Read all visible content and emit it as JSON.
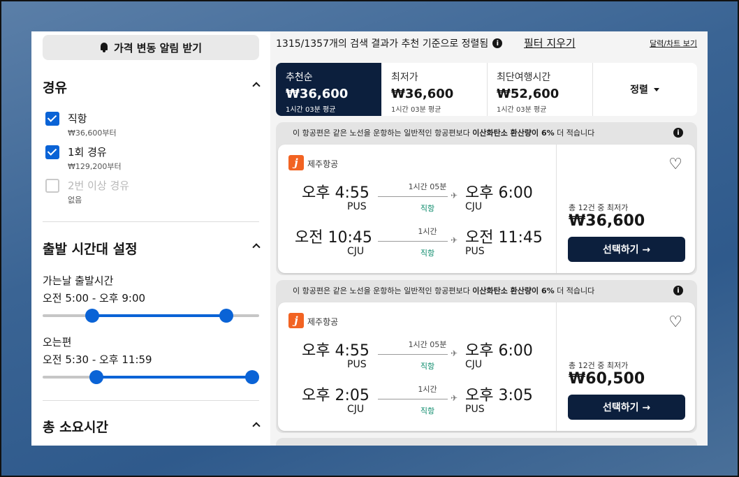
{
  "sidebar": {
    "alert_button": "가격 변동 알림 받기",
    "stops": {
      "title": "경유",
      "options": [
        {
          "label": "직항",
          "sub": "₩36,600부터",
          "checked": true
        },
        {
          "label": "1회 경유",
          "sub": "₩129,200부터",
          "checked": true
        },
        {
          "label": "2번 이상 경유",
          "sub": "없음",
          "checked": false
        }
      ]
    },
    "departure_time": {
      "title": "출발 시간대 설정",
      "outbound_label": "가는날 출발시간",
      "outbound_range": "오전 5:00 - 오후 9:00",
      "return_label": "오는편",
      "return_range": "오전 5:30 - 오후 11:59"
    },
    "duration": {
      "title": "총 소요시간"
    }
  },
  "main": {
    "results_text": "1315/1357개의 검색 결과가 추천 기준으로 정렬됨",
    "info_glyph": "i",
    "clear_filters": "필터 지우기",
    "dollar_chart": "달력/차트 보기",
    "sort_tabs": [
      {
        "label": "추천순",
        "price": "₩36,600",
        "sub": "1시간 03분 평균",
        "active": true
      },
      {
        "label": "최저가",
        "price": "₩36,600",
        "sub": "1시간 03분 평균",
        "active": false
      },
      {
        "label": "최단여행시간",
        "price": "₩52,600",
        "sub": "1시간 03분 평균",
        "active": false
      }
    ],
    "sort_dropdown": "정렬",
    "eco_note_pre": "이 항공편은 같은 노선을 운항하는 일반적인 항공편보다 ",
    "eco_note_bold": "이산화탄소 환산량이 6%",
    "eco_note_post": " 더 적습니다",
    "cards": [
      {
        "airline": "제주항공",
        "logo_letter": "j",
        "legs": [
          {
            "dep_time": "오후 4:55",
            "dep_code": "PUS",
            "duration": "1시간 05분",
            "stops": "직항",
            "arr_time": "오후 6:00",
            "arr_code": "CJU"
          },
          {
            "dep_time": "오전 10:45",
            "dep_code": "CJU",
            "duration": "1시간",
            "stops": "직항",
            "arr_time": "오전 11:45",
            "arr_code": "PUS"
          }
        ],
        "price_sub": "총 12건 중 최저가",
        "price": "₩36,600",
        "select": "선택하기 →"
      },
      {
        "airline": "제주항공",
        "logo_letter": "j",
        "legs": [
          {
            "dep_time": "오후 4:55",
            "dep_code": "PUS",
            "duration": "1시간 05분",
            "stops": "직항",
            "arr_time": "오후 6:00",
            "arr_code": "CJU"
          },
          {
            "dep_time": "오후 2:05",
            "dep_code": "CJU",
            "duration": "1시간",
            "stops": "직항",
            "arr_time": "오후 3:05",
            "arr_code": "PUS"
          }
        ],
        "price_sub": "총 12건 중 최저가",
        "price": "₩60,500",
        "select": "선택하기 →"
      }
    ]
  },
  "colors": {
    "accent": "#0a63d6",
    "navy": "#0c1f3d",
    "brand_jeju": "#f26322",
    "nonstop_green": "#0a8a6a"
  },
  "icons": [
    "bell-icon",
    "chevron-up-icon",
    "info-icon",
    "heart-icon",
    "plane-icon",
    "caret-down-icon",
    "check-icon"
  ]
}
